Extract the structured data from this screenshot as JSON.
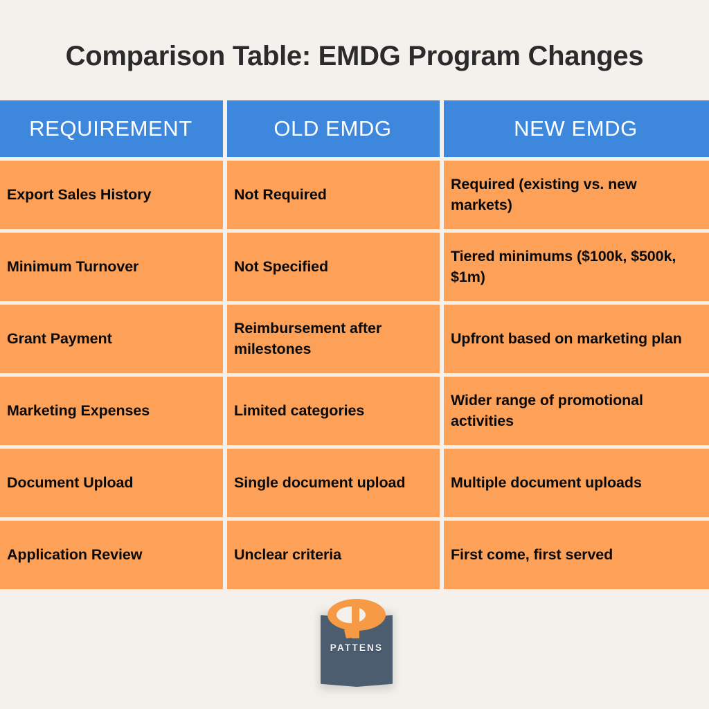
{
  "page": {
    "title": "Comparison Table: EMDG Program Changes",
    "background_color": "#f4f1ec",
    "header_color": "#3d88dd",
    "cell_color": "#fda058",
    "title_color": "#2b2b2b"
  },
  "table": {
    "headers": [
      "REQUIREMENT",
      "OLD EMDG",
      "NEW EMDG"
    ],
    "rows": [
      {
        "requirement": "Export Sales History",
        "old_emdg": "Not Required",
        "new_emdg": "Required (existing vs. new markets)"
      },
      {
        "requirement": "Minimum Turnover",
        "old_emdg": "Not Specified",
        "new_emdg": "Tiered minimums ($100k, $500k, $1m)"
      },
      {
        "requirement": "Grant Payment",
        "old_emdg": "Reimbursement after milestones",
        "new_emdg": "Upfront based on marketing plan"
      },
      {
        "requirement": "Marketing Expenses",
        "old_emdg": "Limited categories",
        "new_emdg": "Wider range of promotional activities"
      },
      {
        "requirement": "Document Upload",
        "old_emdg": "Single document upload",
        "new_emdg": "Multiple document uploads"
      },
      {
        "requirement": "Application Review",
        "old_emdg": "Unclear criteria",
        "new_emdg": "First come, first served"
      }
    ]
  },
  "logo": {
    "wordmark": "PATTENS",
    "mark_icon": "pattens-phi-icon",
    "box_color": "#4d5d70",
    "mark_color": "#f79a46"
  }
}
